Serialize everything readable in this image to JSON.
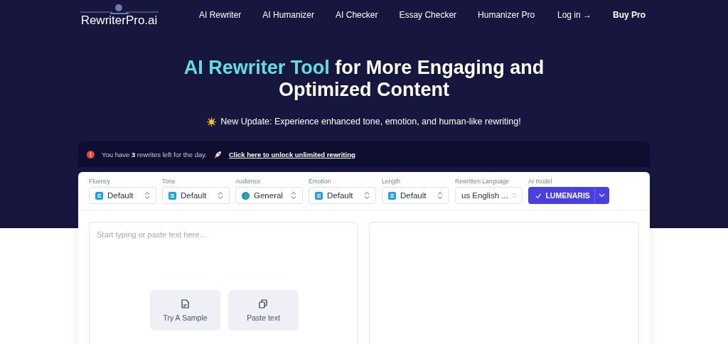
{
  "logo": {
    "text": "RewriterPro.ai"
  },
  "nav": [
    {
      "label": "AI Rewriter"
    },
    {
      "label": "AI Humanizer"
    },
    {
      "label": "AI Checker"
    },
    {
      "label": "Essay Checker"
    },
    {
      "label": "Humanizer Pro"
    }
  ],
  "auth": {
    "login": "Log in →",
    "buy": "Buy Pro"
  },
  "hero": {
    "title_highlight": "AI Rewriter Tool",
    "title_rest": " for More Engaging and Optimized Content",
    "update": "New Update: Experience enhanced tone, emotion, and human-like rewriting!"
  },
  "notice": {
    "text": "You have **3** rewrites left for the day.",
    "link": "Click here to unlock unlimited rewriting"
  },
  "options": [
    {
      "label": "Fluency",
      "value": "Default",
      "kind": "select"
    },
    {
      "label": "Tone",
      "value": "Default",
      "kind": "select"
    },
    {
      "label": "Audience",
      "value": "General",
      "kind": "audience"
    },
    {
      "label": "Emotion",
      "value": "Default",
      "kind": "select"
    },
    {
      "label": "Length",
      "value": "Default",
      "kind": "select"
    },
    {
      "label": "Rewritten Language",
      "value": "us English ...",
      "kind": "language"
    },
    {
      "label": "AI model",
      "value": "LUMENARIS",
      "kind": "model"
    }
  ],
  "editor": {
    "placeholder": "Start typing or paste text here...",
    "actions": [
      {
        "label": "Try A Sample",
        "kind": "sample"
      },
      {
        "label": "Paste text",
        "kind": "paste"
      }
    ]
  }
}
